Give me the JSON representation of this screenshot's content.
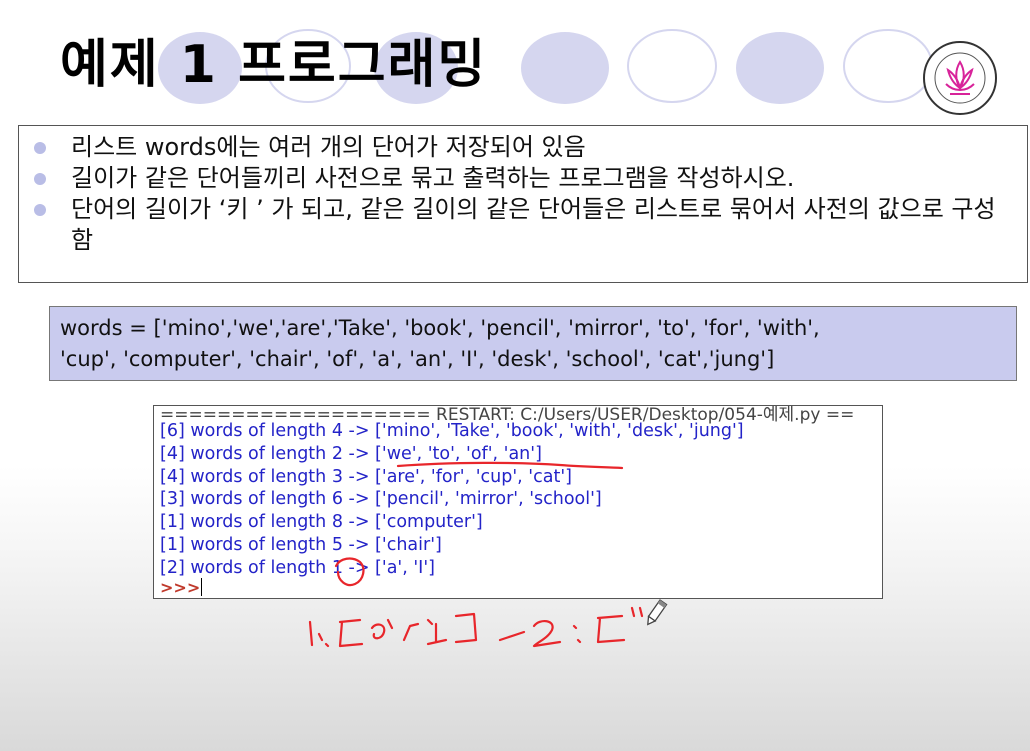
{
  "slide": {
    "title": "예제 1 프로그래밍"
  },
  "bullets": [
    "리스트 words에는 여러 개의 단어가 저장되어 있음",
    "길이가 같은 단어들끼리 사전으로 묶고 출력하는 프로그램을 작성하시오.",
    "단어의 길이가 ‘키 ’ 가 되고, 같은 길이의 같은 단어들은 리스트로 묶어서 사전의 값으로 구성함"
  ],
  "code": {
    "line1": "words = ['mino','we','are','Take', 'book', 'pencil', 'mirror', 'to', 'for', 'with',",
    "line2": "'cup', 'computer', 'chair', 'of', 'a', 'an', 'I', 'desk', 'school', 'cat','jung']"
  },
  "shell": {
    "restart": "=================== RESTART: C:/Users/USER/Desktop/054-예제.py ==",
    "lines": [
      "[6] words of length 4 -> ['mino', 'Take', 'book', 'with', 'desk', 'jung']",
      "[4] words of length 2 -> ['we', 'to', 'of', 'an']",
      "[4] words of length 3 -> ['are', 'for', 'cup', 'cat']",
      "[3] words of length 6 -> ['pencil', 'mirror', 'school']",
      "[1] words of length 8 -> ['computer']",
      "[1] words of length 5 -> ['chair']",
      "[2] words of length 1 -> ['a', 'I']"
    ],
    "prompt": ">>>"
  },
  "colors": {
    "shell_text": "#2323c8",
    "annotation": "#e8262b",
    "code_box": "#c9cbee",
    "bullet_dot": "#b9bde6",
    "deco_circle": "#d5d6ef"
  },
  "logo": {
    "icon": "lotus-seal-icon"
  },
  "annotation": {
    "icon": "pen-cursor-icon"
  }
}
